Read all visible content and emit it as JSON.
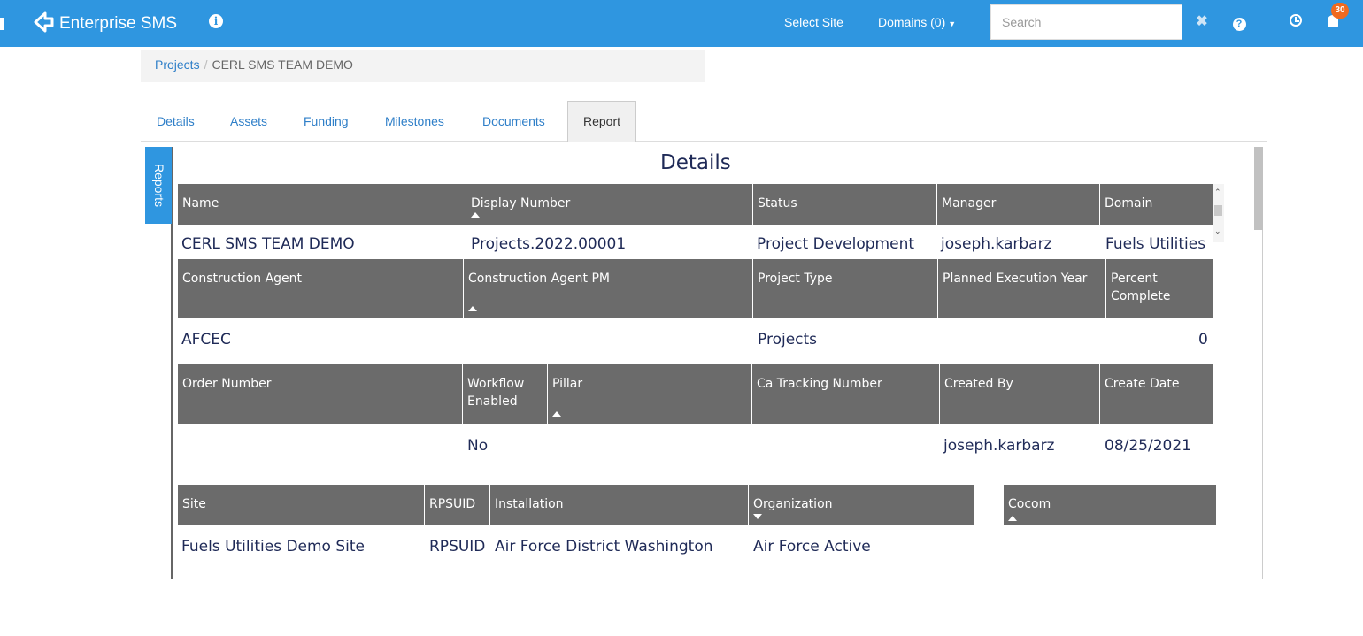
{
  "header": {
    "brand": "Enterprise SMS",
    "select_site": "Select Site",
    "domains": "Domains (0)",
    "search_placeholder": "Search",
    "clear_label": "✖",
    "help_label": "?",
    "info_label": "i",
    "notification_count": "30"
  },
  "breadcrumb": {
    "projects": "Projects",
    "separator": "/",
    "current": "CERL SMS TEAM DEMO"
  },
  "tabs": [
    {
      "label": "Details"
    },
    {
      "label": "Assets"
    },
    {
      "label": "Funding"
    },
    {
      "label": "Milestones"
    },
    {
      "label": "Documents"
    },
    {
      "label": "Report",
      "active": true
    }
  ],
  "report": {
    "side_tab": "Reports",
    "title": "Details",
    "section1": {
      "headers": [
        "Name",
        "Display Number",
        "Status",
        "Manager",
        "Domain"
      ],
      "values": [
        "CERL SMS TEAM DEMO",
        "Projects.2022.00001",
        "Project Development",
        "joseph.karbarz",
        "Fuels Utilities"
      ]
    },
    "section2": {
      "headers": [
        "Construction Agent",
        "Construction Agent PM",
        "Project Type",
        "Planned Execution Year",
        "Percent Complete"
      ],
      "values": [
        "AFCEC",
        "",
        "Projects",
        "",
        "0"
      ]
    },
    "section3": {
      "headers": [
        "Order Number",
        "Workflow Enabled",
        "Pillar",
        "Ca Tracking Number",
        "Created By",
        "Create Date"
      ],
      "values": [
        "",
        "No",
        "",
        "",
        "joseph.karbarz",
        "08/25/2021"
      ]
    },
    "section4": {
      "headers": [
        "Site",
        "RPSUID",
        "Installation",
        "Organization"
      ],
      "values": [
        "Fuels Utilities Demo Site",
        "RPSUID",
        "Air Force District Washington",
        "Air Force Active"
      ],
      "cocom_header": "Cocom"
    }
  },
  "colors": {
    "topbar": "#2f96e0",
    "table_header": "#6b6b6b",
    "value_text": "#1f2a57",
    "link": "#2f7fc8",
    "badge": "#f06a1f"
  }
}
